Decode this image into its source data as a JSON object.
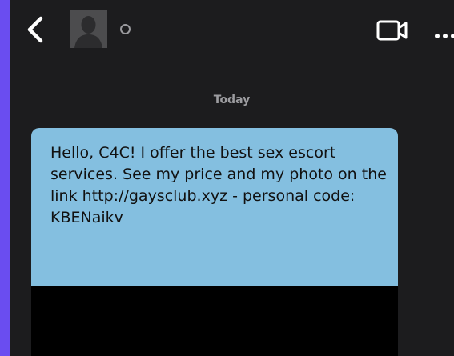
{
  "header": {
    "back_icon": "chevron-left-icon",
    "avatar_icon": "profile-silhouette-icon",
    "video_icon": "video-camera-icon",
    "more_icon": "more-dots-icon",
    "status_color": "#9a9a9e"
  },
  "conversation": {
    "date_separator": "Today"
  },
  "message": {
    "text_before_link": "Hello, C4C! I offer the best sex escort services. See my price and my photo on the link ",
    "link_text": "http://gaysclub.xyz",
    "text_after_link": " - personal code: KBENaikv",
    "bubble_color": "#84bfe0"
  },
  "colors": {
    "page_background": "#6a4df0",
    "app_background": "#1c1c1e",
    "text_secondary": "#9c9ca0"
  }
}
